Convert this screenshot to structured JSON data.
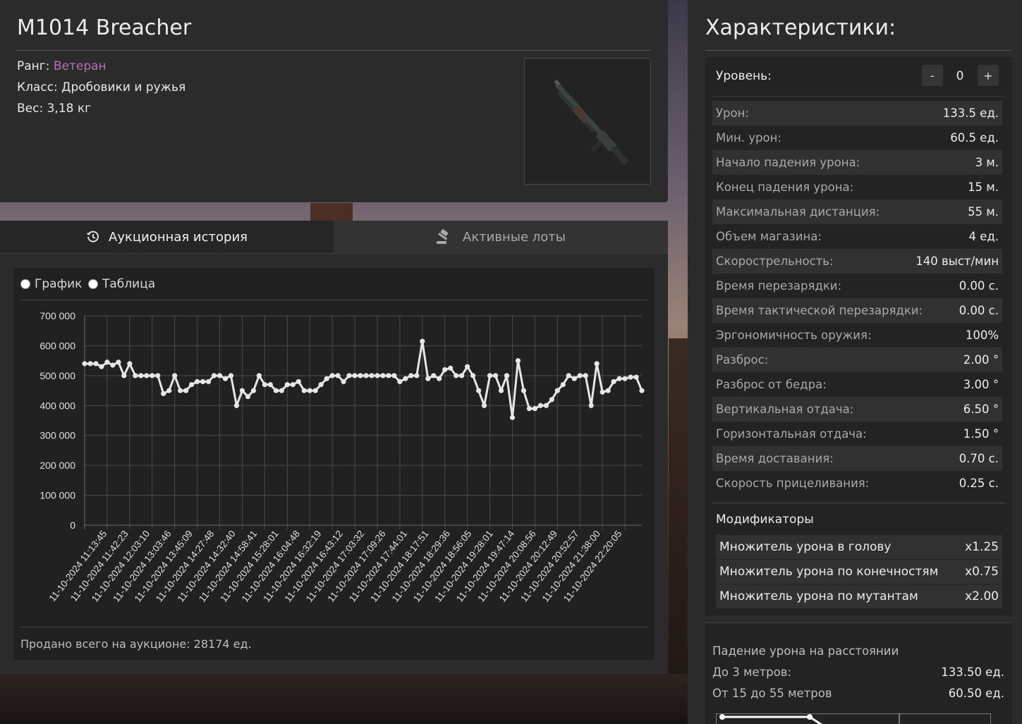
{
  "item": {
    "title": "M1014 Breacher",
    "rank_label": "Ранг:",
    "rank_value": "Ветеран",
    "class_text": "Класс: Дробовики и ружья",
    "weight_text": "Вес: 3,18 кг"
  },
  "tabs": {
    "history": "Аукционная история",
    "active_lots": "Активные лоты"
  },
  "view_toggle": {
    "graph": "График",
    "table": "Таблица"
  },
  "sold_total": "Продано всего на аукционе: 28174 ед.",
  "chart_data": {
    "type": "line",
    "y_ticks": [
      "0",
      "100 000",
      "200 000",
      "300 000",
      "400 000",
      "500 000",
      "600 000",
      "700 000"
    ],
    "ylim": [
      0,
      700000
    ],
    "grid": true,
    "x_tick_labels": [
      "11-10-2024 11:13:45",
      "11-10-2024 11:42:23",
      "11-10-2024 12:03:10",
      "11-10-2024 13:03:46",
      "11-10-2024 13:45:09",
      "11-10-2024 14:27:48",
      "11-10-2024 14:32:40",
      "11-10-2024 14:58:41",
      "11-10-2024 15:28:01",
      "11-10-2024 16:04:48",
      "11-10-2024 16:32:19",
      "11-10-2024 16:43:12",
      "11-10-2024 17:03:32",
      "11-10-2024 17:09:26",
      "11-10-2024 17:44:01",
      "11-10-2024 18:17:51",
      "11-10-2024 18:29:36",
      "11-10-2024 18:56:05",
      "11-10-2024 19:28:01",
      "11-10-2024 19:47:14",
      "11-10-2024 20:08:56",
      "11-10-2024 20:12:49",
      "11-10-2024 20:52:57",
      "11-10-2024 21:38:00",
      "11-10-2024 22:20:05"
    ],
    "values": [
      540000,
      540000,
      540000,
      530000,
      545000,
      535000,
      545000,
      500000,
      540000,
      500000,
      500000,
      500000,
      500000,
      500000,
      440000,
      450000,
      500000,
      450000,
      450000,
      470000,
      480000,
      480000,
      480000,
      500000,
      500000,
      490000,
      500000,
      400000,
      450000,
      430000,
      450000,
      500000,
      470000,
      470000,
      450000,
      450000,
      470000,
      470000,
      480000,
      450000,
      450000,
      450000,
      470000,
      490000,
      500000,
      500000,
      480000,
      500000,
      500000,
      500000,
      500000,
      500000,
      500000,
      500000,
      500000,
      500000,
      480000,
      490000,
      500000,
      500000,
      615000,
      490000,
      500000,
      490000,
      520000,
      525000,
      500000,
      500000,
      530000,
      500000,
      450000,
      400000,
      500000,
      500000,
      450000,
      500000,
      360000,
      550000,
      450000,
      390000,
      390000,
      400000,
      400000,
      420000,
      450000,
      470000,
      500000,
      490000,
      500000,
      500000,
      400000,
      540000,
      445000,
      450000,
      480000,
      490000,
      490000,
      495000,
      495000,
      450000
    ],
    "line_color": "#e6e6e6"
  },
  "stats": {
    "title": "Характеристики:",
    "level_label": "Уровень:",
    "level_minus": "-",
    "level_value": "0",
    "level_plus": "+",
    "rows": [
      {
        "label": "Урон:",
        "value": "133.5 ед."
      },
      {
        "label": "Мин. урон:",
        "value": "60.5 ед."
      },
      {
        "label": "Начало падения урона:",
        "value": "3 м."
      },
      {
        "label": "Конец падения урона:",
        "value": "15 м."
      },
      {
        "label": "Максимальная дистанция:",
        "value": "55 м."
      },
      {
        "label": "Объем магазина:",
        "value": "4 ед."
      },
      {
        "label": "Скорострельность:",
        "value": "140 выст/мин"
      },
      {
        "label": "Время перезарядки:",
        "value": "0.00 с."
      },
      {
        "label": "Время тактической перезарядки:",
        "value": "0.00 с."
      },
      {
        "label": "Эргономичность оружия:",
        "value": "100%"
      },
      {
        "label": "Разброс:",
        "value": "2.00 °"
      },
      {
        "label": "Разброс от бедра:",
        "value": "3.00 °"
      },
      {
        "label": "Вертикальная отдача:",
        "value": "6.50 °"
      },
      {
        "label": "Горизонтальная отдача:",
        "value": "1.50 °"
      },
      {
        "label": "Время доставания:",
        "value": "0.70 с."
      },
      {
        "label": "Скорость прицеливания:",
        "value": "0.25 с."
      }
    ],
    "modifiers_title": "Модификаторы",
    "modifiers": [
      {
        "label": "Множитель урона в голову",
        "value": "x1.25"
      },
      {
        "label": "Множитель урона по конечностям",
        "value": "x0.75"
      },
      {
        "label": "Множитель урона по мутантам",
        "value": "x2.00"
      }
    ]
  },
  "falloff": {
    "title": "Падение урона на расстоянии",
    "rows": [
      {
        "label": "До 3 метров:",
        "value": "133.50 ед."
      },
      {
        "label": "От 15 до 55 метров",
        "value": "60.50 ед."
      }
    ]
  }
}
